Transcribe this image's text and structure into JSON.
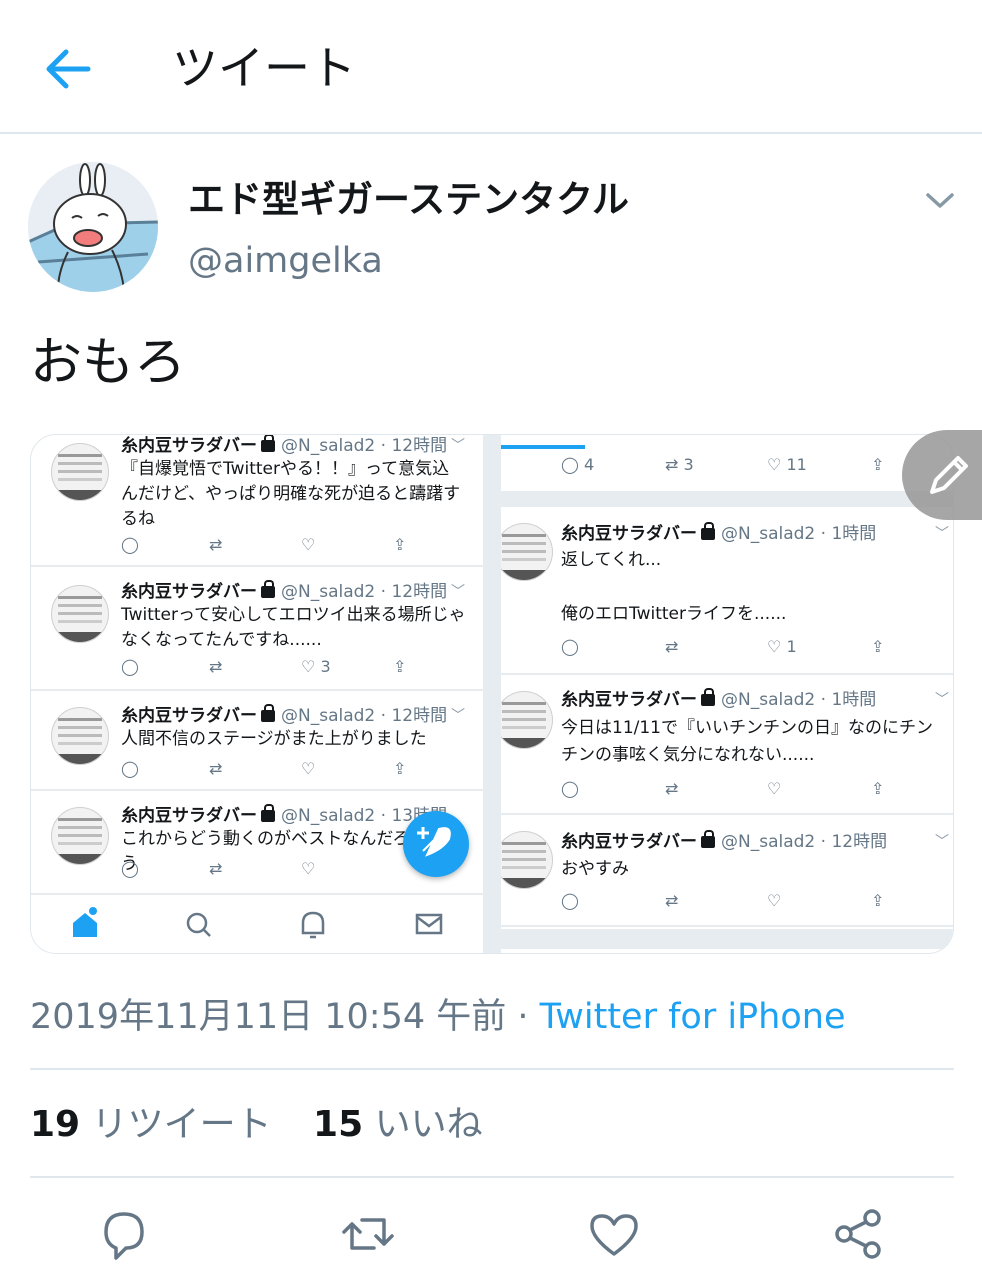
{
  "header": {
    "title": "ツイート"
  },
  "author": {
    "display_name": "エド型ギガーステンタクル",
    "handle": "@aimgelka"
  },
  "tweet": {
    "text": "おもろ"
  },
  "media": {
    "left": {
      "tweets": [
        {
          "name": "糸内豆サラダバー",
          "handle_time": "@N_salad2 · 12時間",
          "text": "『自爆覚悟でTwitterやる！！』って意気込んだけど、やっぱり明確な死が迫ると躊躇するね",
          "likes": ""
        },
        {
          "name": "糸内豆サラダバー",
          "handle_time": "@N_salad2 · 12時間",
          "text": "Twitterって安心してエロツイ出来る場所じゃなくなってたんですね......",
          "likes": "3"
        },
        {
          "name": "糸内豆サラダバー",
          "handle_time": "@N_salad2 · 12時間",
          "text": "人間不信のステージがまた上がりました",
          "likes": ""
        },
        {
          "name": "糸内豆サラダバー",
          "handle_time": "@N_salad2 · 13時間",
          "text": "これからどう動くのがベストなんだろう",
          "likes": ""
        }
      ]
    },
    "right": {
      "top_actions": {
        "replies": "4",
        "retweets": "3",
        "likes": "11"
      },
      "tweets": [
        {
          "name": "糸内豆サラダバー",
          "handle_time": "@N_salad2 · 1時間",
          "text": "返してくれ...\n\n俺のエロTwitterライフを......",
          "likes": "1"
        },
        {
          "name": "糸内豆サラダバー",
          "handle_time": "@N_salad2 · 1時間",
          "text": "今日は11/11で『いいチンチンの日』なのにチンチンの事呟く気分になれない......",
          "likes": ""
        },
        {
          "name": "糸内豆サラダバー",
          "handle_time": "@N_salad2 · 12時間",
          "text": "おやすみ",
          "likes": ""
        }
      ]
    }
  },
  "meta": {
    "timestamp": "2019年11月11日 10:54 午前",
    "separator": " · ",
    "source": "Twitter for iPhone"
  },
  "stats": {
    "retweets_count": "19",
    "retweets_label": "リツイート",
    "likes_count": "15",
    "likes_label": "いいね"
  },
  "colors": {
    "accent": "#1da1f2",
    "muted": "#657786",
    "text": "#14171a",
    "divider": "#e1e8ed"
  },
  "icons": [
    "back-arrow-icon",
    "chevron-down-icon",
    "reply-icon",
    "retweet-icon",
    "like-icon",
    "share-icon",
    "compose-icon",
    "edit-icon",
    "home-icon",
    "search-icon",
    "bell-icon",
    "mail-icon",
    "lock-icon"
  ]
}
